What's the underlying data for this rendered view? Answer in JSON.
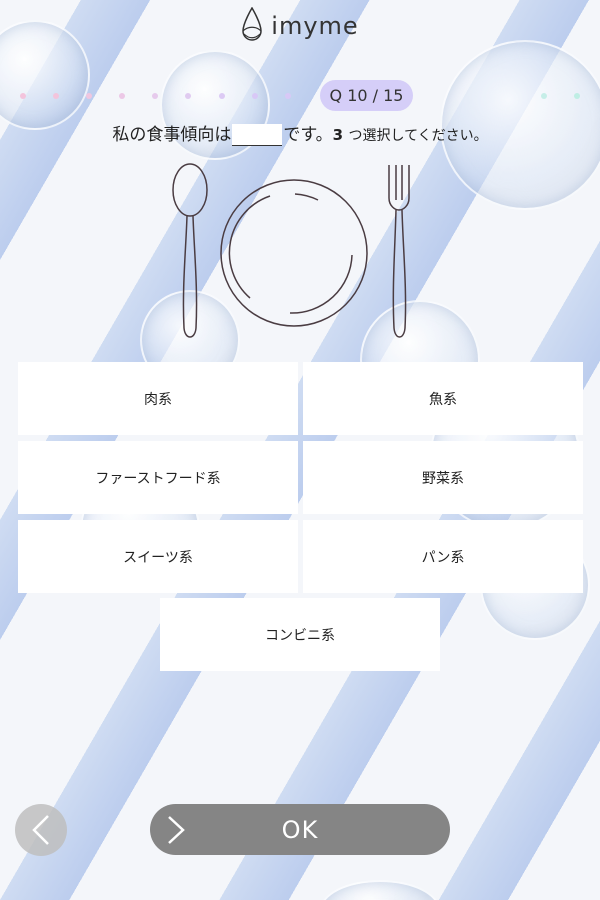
{
  "app": {
    "logo_text": "imyme"
  },
  "progress": {
    "current": 10,
    "total": 15,
    "badge_label": "Q 10 / 15"
  },
  "question": {
    "prefix": "私の食事傾向は",
    "suffix": "です。",
    "count": "3",
    "instruction": "つ選択してください。"
  },
  "options": [
    {
      "label": "肉系"
    },
    {
      "label": "魚系"
    },
    {
      "label": "ファーストフード系"
    },
    {
      "label": "野菜系"
    },
    {
      "label": "スイーツ系"
    },
    {
      "label": "パン系"
    },
    {
      "label": "コンビニ系"
    }
  ],
  "actions": {
    "ok_label": "OK"
  },
  "colors": {
    "badge": "#d5cef8",
    "ok_button": "#858585",
    "back_button": "#bebebe",
    "dots_pink": "#f3c4dc",
    "dots_purple": "#d8c8f6",
    "dots_teal": "#bfeee4"
  },
  "icons": {
    "logo": "water-drop-icon",
    "back": "chevron-left-icon",
    "ok": "chevron-right-icon",
    "illustration": "spoon-plate-fork-icon"
  }
}
